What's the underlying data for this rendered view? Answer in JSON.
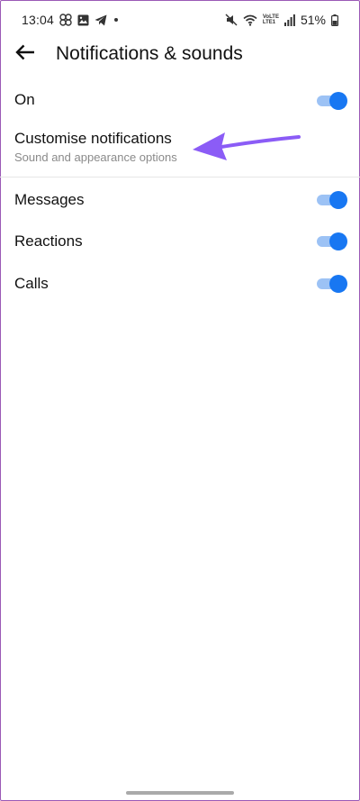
{
  "status_bar": {
    "time": "13:04",
    "network_label_top": "VoLTE",
    "network_label_bottom": "LTE1",
    "battery": "51%"
  },
  "header": {
    "title": "Notifications & sounds"
  },
  "settings": {
    "on": {
      "label": "On",
      "enabled": true
    },
    "customise": {
      "label": "Customise notifications",
      "subtitle": "Sound and appearance options"
    },
    "messages": {
      "label": "Messages",
      "enabled": true
    },
    "reactions": {
      "label": "Reactions",
      "enabled": true
    },
    "calls": {
      "label": "Calls",
      "enabled": true
    }
  },
  "colors": {
    "toggle_on_knob": "#1877f2",
    "toggle_on_track": "#9cc2f5",
    "annotation_arrow": "#8b5cf6"
  }
}
